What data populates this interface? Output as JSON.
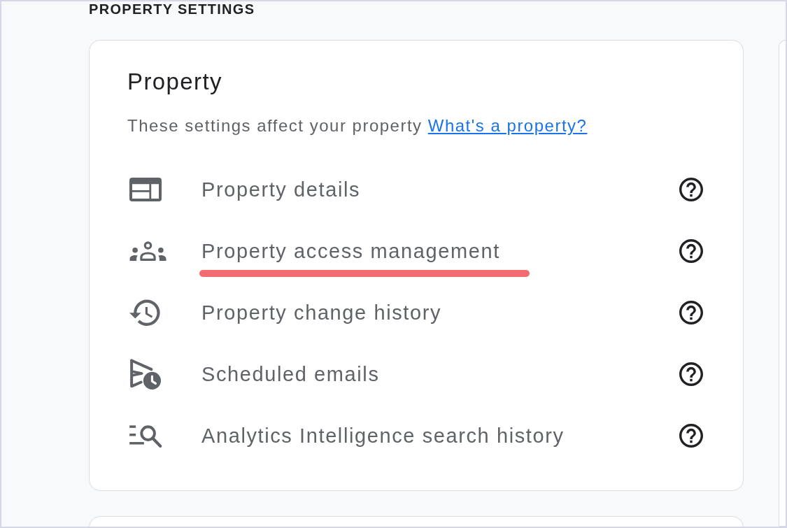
{
  "section_heading": "PROPERTY SETTINGS",
  "card": {
    "title": "Property",
    "description": "These settings affect your property",
    "help_link": "What's a property?",
    "items": [
      {
        "kind": "details",
        "label": "Property details",
        "highlighted": false
      },
      {
        "kind": "access",
        "label": "Property access management",
        "highlighted": true
      },
      {
        "kind": "history",
        "label": "Property change history",
        "highlighted": false
      },
      {
        "kind": "emails",
        "label": "Scheduled emails",
        "highlighted": false
      },
      {
        "kind": "search",
        "label": "Analytics Intelligence search history",
        "highlighted": false
      }
    ]
  }
}
